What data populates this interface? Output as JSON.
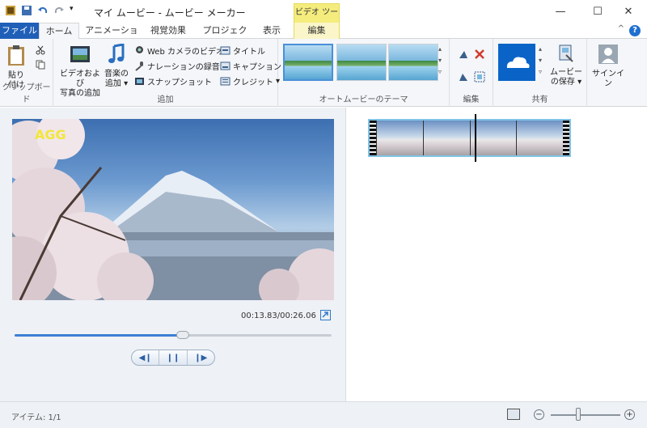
{
  "window": {
    "title": "マイ ムービー - ムービー メーカー",
    "context_tab_title": "ビデオ ツール",
    "minimize": "—",
    "maximize": "☐",
    "close": "✕"
  },
  "tabs": {
    "file": "ファイル",
    "home": "ホーム",
    "animation": "アニメーション",
    "visual_effects": "視覚効果",
    "project": "プロジェクト",
    "view": "表示",
    "edit": "編集"
  },
  "ribbon": {
    "clipboard": {
      "paste": "貼り付け",
      "paste_line1": "貼り",
      "paste_line2": "付け",
      "group": "クリップボード"
    },
    "add": {
      "add_video_line1": "ビデオおよび",
      "add_video_line2": "写真の追加",
      "add_music_line1": "音楽の",
      "add_music_line2": "追加",
      "webcam": "Web カメラのビデオ",
      "narration": "ナレーションの録音",
      "snapshot": "スナップショット",
      "title": "タイトル",
      "caption": "キャプション",
      "credits": "クレジット",
      "group": "追加"
    },
    "automovie": {
      "group": "オートムービーのテーマ"
    },
    "editing": {
      "group": "編集"
    },
    "share": {
      "save_line1": "ムービー",
      "save_line2": "の保存",
      "group": "共有"
    },
    "signin": "サインイン"
  },
  "preview": {
    "watermark": "AGG",
    "time": "00:13.83/00:26.06",
    "progress": 0.53
  },
  "status": {
    "items": "アイテム: 1/1",
    "zoom_level": 0.4
  },
  "colors": {
    "file_tab": "#1f5fb8",
    "context_tab": "#f5ec7e",
    "selection": "#7fc3e6"
  }
}
